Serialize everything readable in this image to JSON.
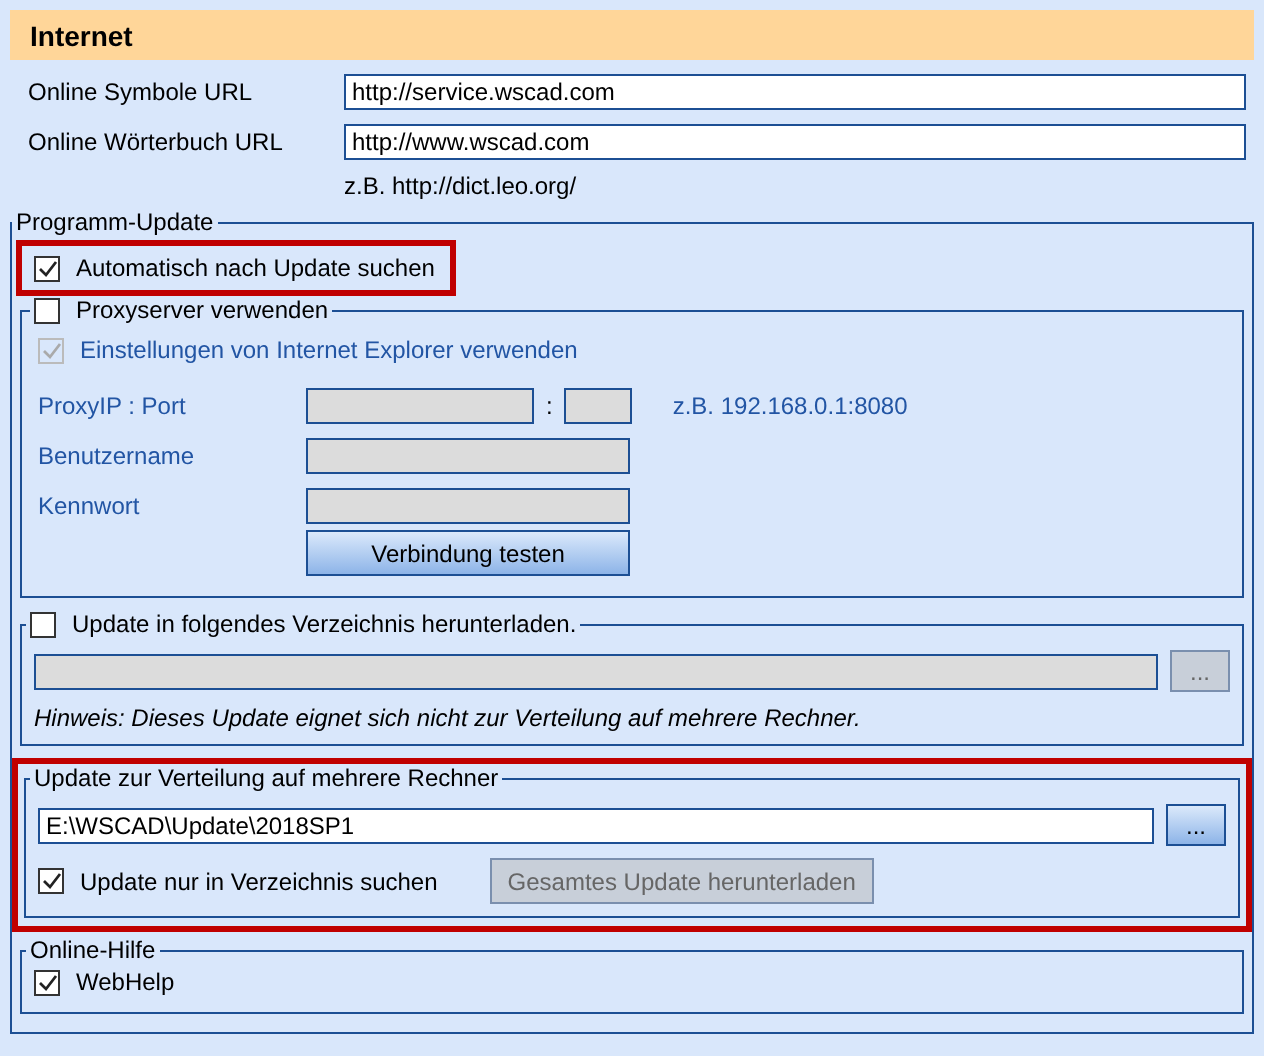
{
  "header": {
    "title": "Internet"
  },
  "url_fields": [
    {
      "label": "Online Symbole URL",
      "value": "http://service.wscad.com"
    },
    {
      "label": "Online Wörterbuch URL",
      "value": "http://www.wscad.com",
      "hint": "z.B. http://dict.leo.org/"
    }
  ],
  "program_update": {
    "title": "Programm-Update",
    "auto_update": {
      "label": "Automatisch nach Update suchen",
      "checked": true,
      "highlighted": true
    },
    "proxy": {
      "label": "Proxyserver verwenden",
      "checked": false,
      "ie_settings": {
        "label": "Einstellungen von Internet Explorer verwenden",
        "checked": true,
        "disabled": true
      },
      "proxy_ip": {
        "label": "ProxyIP : Port",
        "separator": ":",
        "hint": "z.B. 192.168.0.1:8080",
        "disabled": true
      },
      "username": {
        "label": "Benutzername",
        "disabled": true
      },
      "password": {
        "label": "Kennwort",
        "disabled": true
      },
      "test_button": {
        "label": "Verbindung testen"
      }
    },
    "download_dir": {
      "label": "Update in folgendes Verzeichnis herunterladen.",
      "checked": false,
      "disabled": true,
      "browse": "...",
      "note": "Hinweis: Dieses Update eignet sich nicht zur Verteilung auf mehrere Rechner."
    },
    "distribution": {
      "title": "Update zur Verteilung auf mehrere Rechner",
      "highlighted": true,
      "path": "E:\\WSCAD\\Update\\2018SP1",
      "browse": "...",
      "search_only": {
        "label": "Update nur in Verzeichnis suchen",
        "checked": true
      },
      "download_button": {
        "label": "Gesamtes Update herunterladen",
        "disabled": true
      }
    }
  },
  "online_help": {
    "title": "Online-Hilfe",
    "webhelp": {
      "label": "WebHelp",
      "checked": true
    }
  }
}
